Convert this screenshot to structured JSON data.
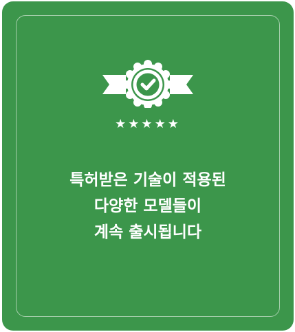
{
  "card": {
    "background": "#3c964b",
    "border_color": "rgba(255,255,255,0.55)",
    "badge_icon": "award-ribbon-check-icon",
    "rating_icon": "five-star-rating-icon",
    "stars": "★★★★★",
    "headline_lines": [
      "특허받은 기술이 적용된",
      "다양한 모델들이",
      "계속 출시됩니다"
    ]
  }
}
